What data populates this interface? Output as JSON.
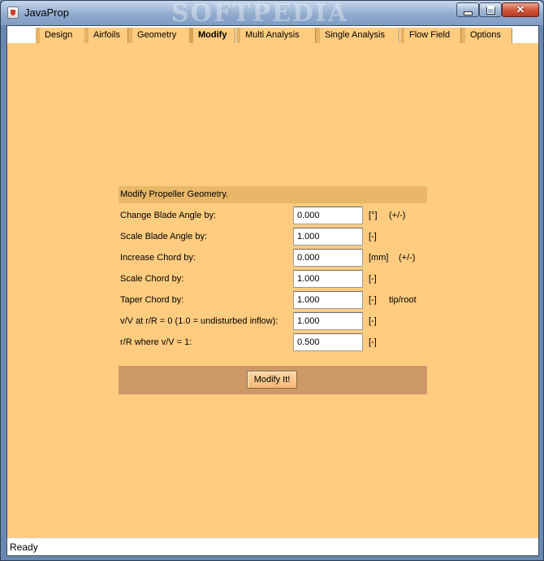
{
  "window": {
    "title": "JavaProp",
    "watermark": "SOFTPEDIA"
  },
  "tabs": [
    {
      "label": "Design"
    },
    {
      "label": "Airfoils"
    },
    {
      "label": "Geometry"
    },
    {
      "label": "Modify",
      "active": true
    },
    {
      "label": "Multi Analysis"
    },
    {
      "label": "Single Analysis"
    },
    {
      "label": "Flow Field"
    },
    {
      "label": "Options"
    }
  ],
  "form": {
    "header": "Modify Propeller Geometry.",
    "rows": [
      {
        "label": "Change Blade Angle by:",
        "value": "0.000",
        "unit": "[°]",
        "note": "(+/-)"
      },
      {
        "label": "Scale Blade Angle by:",
        "value": "1.000",
        "unit": "[-]",
        "note": ""
      },
      {
        "label": "Increase Chord by:",
        "value": "0.000",
        "unit": "[mm]",
        "note": "(+/-)"
      },
      {
        "label": "Scale Chord by:",
        "value": "1.000",
        "unit": "[-]",
        "note": ""
      },
      {
        "label": "Taper Chord by:",
        "value": "1.000",
        "unit": "[-]",
        "note": "tip/root"
      },
      {
        "label": "v/V at r/R = 0 (1.0 = undisturbed inflow):",
        "value": "1.000",
        "unit": "[-]",
        "note": ""
      },
      {
        "label": "r/R where v/V = 1:",
        "value": "0.500",
        "unit": "[-]",
        "note": ""
      }
    ],
    "action_label": "Modify It!"
  },
  "status": {
    "text": "Ready"
  },
  "colors": {
    "panel_background": "#ffcc80",
    "header_band": "#e8b868",
    "action_band": "#cc9966"
  }
}
